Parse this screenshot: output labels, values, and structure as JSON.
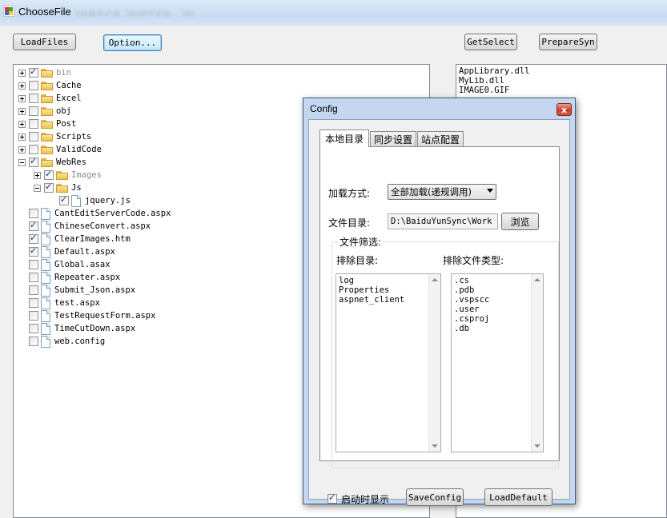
{
  "window": {
    "title": "ChooseFile",
    "title_blur": "飞秋聊天记录   飞秋软件论坛 - 飞秋"
  },
  "toolbar": {
    "load_files": "LoadFiles",
    "option": "Option...",
    "get_select": "GetSelect",
    "prepare_syn": "PrepareSyn"
  },
  "tree": [
    {
      "label": "bin",
      "type": "folder",
      "checked": true,
      "expander": "plus",
      "indent": 0,
      "dim": true
    },
    {
      "label": "Cache",
      "type": "folder",
      "checked": false,
      "expander": "plus",
      "indent": 0
    },
    {
      "label": "Excel",
      "type": "folder",
      "checked": false,
      "expander": "plus",
      "indent": 0
    },
    {
      "label": "obj",
      "type": "folder",
      "checked": false,
      "expander": "plus",
      "indent": 0
    },
    {
      "label": "Post",
      "type": "folder",
      "checked": false,
      "expander": "plus",
      "indent": 0
    },
    {
      "label": "Scripts",
      "type": "folder",
      "checked": false,
      "expander": "plus",
      "indent": 0
    },
    {
      "label": "ValidCode",
      "type": "folder",
      "checked": false,
      "expander": "plus",
      "indent": 0
    },
    {
      "label": "WebRes",
      "type": "folder",
      "checked": true,
      "expander": "minus",
      "indent": 0
    },
    {
      "label": "Images",
      "type": "folder",
      "checked": true,
      "expander": "plus",
      "indent": 1,
      "dim": true
    },
    {
      "label": "Js",
      "type": "folder",
      "checked": true,
      "expander": "minus",
      "indent": 1
    },
    {
      "label": "jquery.js",
      "type": "file",
      "checked": true,
      "expander": "none",
      "indent": 2
    },
    {
      "label": "CantEditServerCode.aspx",
      "type": "file",
      "checked": false,
      "expander": "none",
      "indent": 0
    },
    {
      "label": "ChineseConvert.aspx",
      "type": "file",
      "checked": true,
      "expander": "none",
      "indent": 0
    },
    {
      "label": "ClearImages.htm",
      "type": "file",
      "checked": true,
      "expander": "none",
      "indent": 0
    },
    {
      "label": "Default.aspx",
      "type": "file",
      "checked": true,
      "expander": "none",
      "indent": 0
    },
    {
      "label": "Global.asax",
      "type": "file",
      "checked": false,
      "expander": "none",
      "indent": 0
    },
    {
      "label": "Repeater.aspx",
      "type": "file",
      "checked": false,
      "expander": "none",
      "indent": 0
    },
    {
      "label": "Submit_Json.aspx",
      "type": "file",
      "checked": false,
      "expander": "none",
      "indent": 0
    },
    {
      "label": "test.aspx",
      "type": "file",
      "checked": false,
      "expander": "none",
      "indent": 0
    },
    {
      "label": "TestRequestForm.aspx",
      "type": "file",
      "checked": false,
      "expander": "none",
      "indent": 0
    },
    {
      "label": "TimeCutDown.aspx",
      "type": "file",
      "checked": false,
      "expander": "none",
      "indent": 0
    },
    {
      "label": "web.config",
      "type": "file",
      "checked": false,
      "expander": "none",
      "indent": 0
    }
  ],
  "selected_list": [
    "AppLibrary.dll",
    "MyLib.dll",
    "IMAGE0.GIF"
  ],
  "dialog": {
    "title": "Config",
    "close": "x",
    "tabs": [
      "本地目录",
      "同步设置",
      "站点配置"
    ],
    "load_mode_label": "加载方式:",
    "load_mode_value": "全部加载(递规调用)",
    "dir_label": "文件目录:",
    "dir_value": "D:\\BaiduYunSync\\Work S",
    "browse": "浏览",
    "filter_group": "文件筛选:",
    "exclude_dirs_label": "排除目录:",
    "exclude_types_label": "排除文件类型:",
    "exclude_dirs": [
      "log",
      "Properties",
      "aspnet_client"
    ],
    "exclude_types": [
      ".cs",
      ".pdb",
      ".vspscc",
      ".user",
      ".csproj",
      ".db"
    ],
    "startup_label": "启动时显示",
    "startup_checked": true,
    "save_config": "SaveConfig",
    "load_default": "LoadDefault"
  },
  "colors": {
    "title_bar": "#c9dcf0",
    "dialog_frame": "#c4d7ef",
    "close_red": "#c7422b"
  }
}
